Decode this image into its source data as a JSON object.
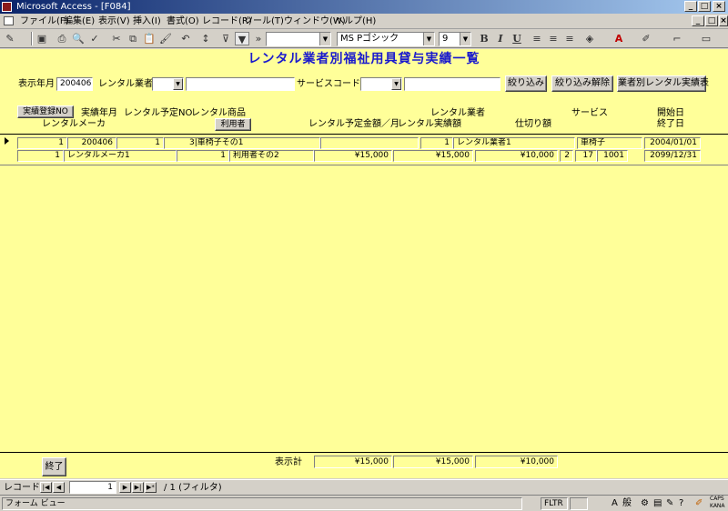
{
  "window": {
    "title": "Microsoft Access - [F084]"
  },
  "menu": [
    "ファイル(F)",
    "編集(E)",
    "表示(V)",
    "挿入(I)",
    "書式(O)",
    "レコード(R)",
    "ツール(T)",
    "ウィンドウ(W)",
    "ヘルプ(H)"
  ],
  "toolbar": {
    "font_name": "MS Pゴシック",
    "font_size": "9",
    "bold": "B",
    "italic": "I",
    "underline": "U"
  },
  "form": {
    "title": "レンタル業者別福祉用具貸与実績一覧",
    "filter": {
      "display_month_label": "表示年月",
      "display_month_value": "200406",
      "rental_vendor_label": "レンタル業者",
      "rental_vendor_value": "",
      "service_code_label": "サービスコード",
      "service_code_value": ""
    },
    "buttons": {
      "filter": "絞り込み",
      "unfilter": "絞り込み解除",
      "report": "業者別レンタル実績表",
      "user": "利用者",
      "record_no": "実績登録NO",
      "exit": "終了"
    },
    "headers": {
      "record_month": "実績年月",
      "rental_plan_no": "レンタル予定NO",
      "rental_product": "レンタル商品",
      "rental_maker": "レンタルメーカ",
      "planned_amount": "レンタル予定金額／月",
      "rental_vendor": "レンタル業者",
      "actual_amount": "レンタル実績額",
      "purchase_amount": "仕切り額",
      "service": "サービス",
      "start_date": "開始日",
      "end_date": "終了日"
    },
    "record": {
      "record_no": "1",
      "record_month": "200406",
      "plan_no": "1",
      "product": "3|車椅子その1",
      "planned_blank": "",
      "vendor_no": "1",
      "vendor_name": "レンタル業者1",
      "service_name": "車椅子",
      "start_date": "2004/01/01",
      "maker_no": "1",
      "maker_name": "レンタルメーカ1",
      "user_no": "1",
      "user_name": "利用者その2",
      "planned_amount": "¥15,000",
      "actual_amount": "¥15,000",
      "purchase_amount": "¥10,000",
      "service_type": "2",
      "service_code_a": "17",
      "service_code_b": "1001",
      "end_date": "2099/12/31"
    },
    "totals": {
      "label": "表示計",
      "planned": "¥15,000",
      "actual": "¥15,000",
      "purchase": "¥10,000"
    }
  },
  "nav": {
    "label": "レコード:",
    "current": "1",
    "total": "/ 1 (フィルタ)"
  },
  "status": {
    "view": "フォーム ビュー",
    "fltr": "FLTR",
    "ime": "般",
    "caps": "CAPS",
    "kana": "KANA"
  }
}
